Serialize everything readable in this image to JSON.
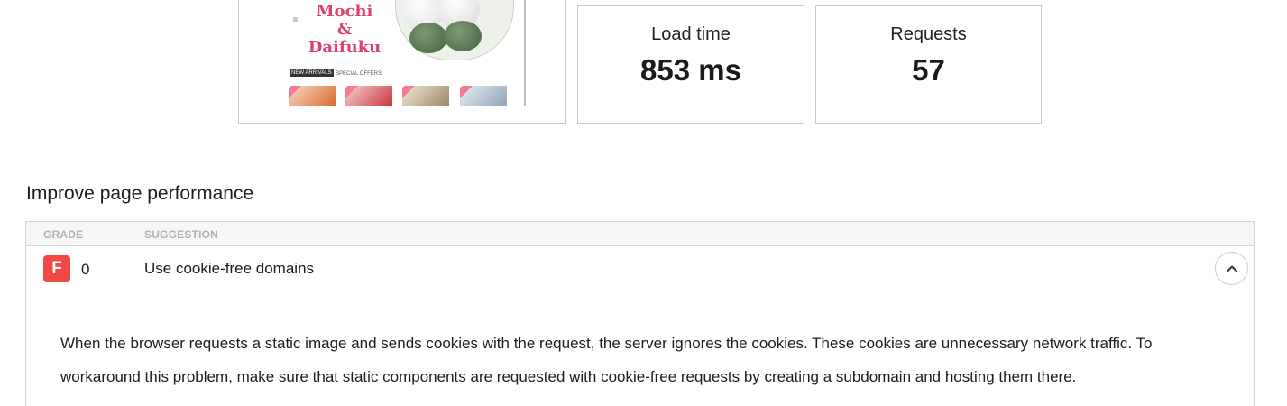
{
  "thumbnail": {
    "title_lines": [
      "Mochi",
      "&",
      "Daifuku"
    ],
    "new_arrivals": "NEW ARRIVALS",
    "special_offers": "SPECIAL OFFERS"
  },
  "metrics": {
    "load_time": {
      "label": "Load time",
      "value": "853 ms"
    },
    "requests": {
      "label": "Requests",
      "value": "57"
    }
  },
  "section": {
    "title": "Improve page performance",
    "columns": {
      "grade": "GRADE",
      "suggestion": "SUGGESTION"
    },
    "rows": [
      {
        "grade": "F",
        "score": "0",
        "suggestion": "Use cookie-free domains",
        "grade_color": "#f04747",
        "expanded": true,
        "detail": "When the browser requests a static image and sends cookies with the request, the server ignores the cookies. These cookies are unnecessary network traffic. To workaround this problem, make sure that static components are requested with cookie-free requests by creating a subdomain and hosting them there."
      }
    ]
  },
  "icons": {
    "toggle": "chevron-up-icon"
  }
}
